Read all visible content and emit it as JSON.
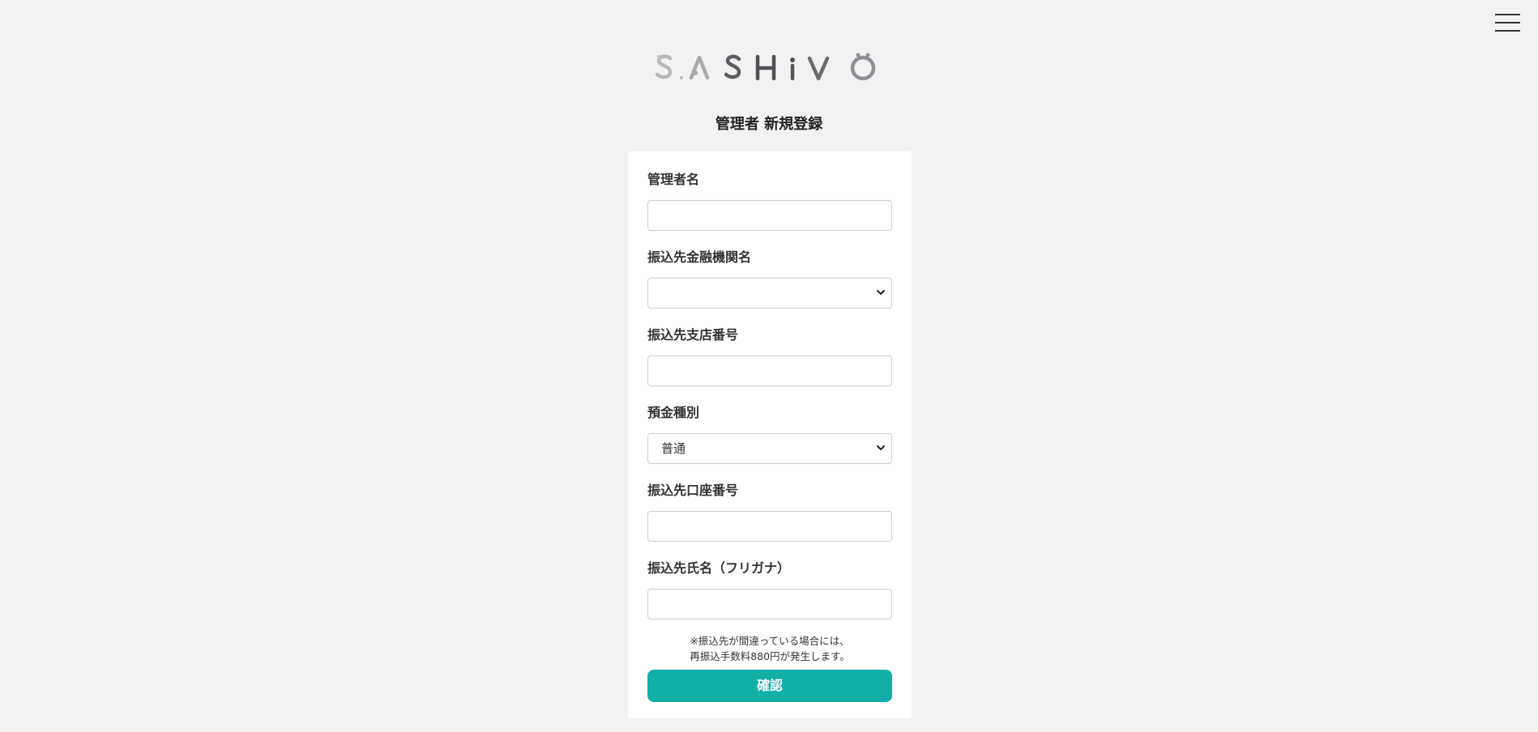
{
  "header": {
    "menu_icon": "hamburger-menu-icon",
    "logo_text": "SASHIVO"
  },
  "page": {
    "title": "管理者 新規登録"
  },
  "form": {
    "fields": [
      {
        "label": "管理者名",
        "type": "text",
        "value": ""
      },
      {
        "label": "振込先金融機関名",
        "type": "select",
        "value": ""
      },
      {
        "label": "振込先支店番号",
        "type": "text",
        "value": ""
      },
      {
        "label": "預金種別",
        "type": "select",
        "value": "普通"
      },
      {
        "label": "振込先口座番号",
        "type": "text",
        "value": ""
      },
      {
        "label": "振込先氏名（フリガナ）",
        "type": "text",
        "value": ""
      }
    ],
    "note_line1": "※振込先が間違っている場合には、",
    "note_line2": "再振込手数料880円が発生します。",
    "confirm_label": "確認"
  },
  "colors": {
    "background": "#f2f2f2",
    "card": "#ffffff",
    "accent": "#12aea8",
    "text": "#333333"
  }
}
